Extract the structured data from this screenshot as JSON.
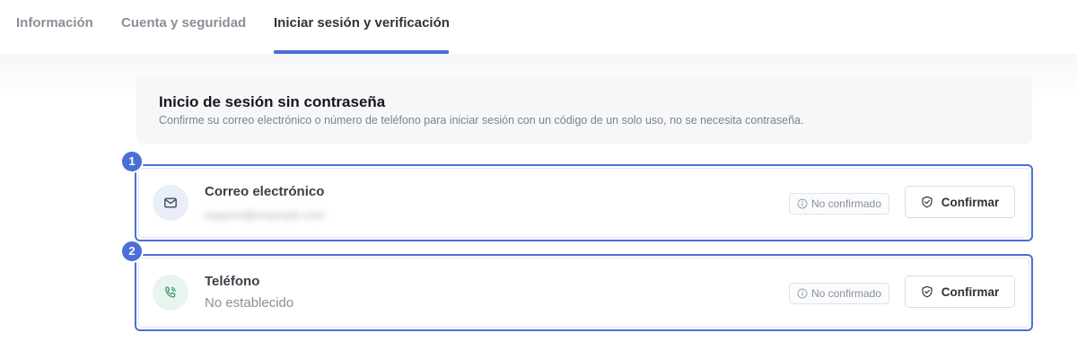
{
  "tabs": [
    {
      "label": "Información",
      "active": false
    },
    {
      "label": "Cuenta y seguridad",
      "active": false
    },
    {
      "label": "Iniciar sesión y verificación",
      "active": true
    }
  ],
  "section": {
    "title": "Inicio de sesión sin contraseña",
    "description": "Confirme su correo electrónico o número de teléfono para iniciar sesión con un código de un solo uso, no se necesita contraseña."
  },
  "rows": [
    {
      "marker": "1",
      "icon": "mail-icon",
      "title": "Correo electrónico",
      "value": "support@example.com",
      "value_blurred": true,
      "status": "No confirmado",
      "action": "Confirmar"
    },
    {
      "marker": "2",
      "icon": "phone-icon",
      "title": "Teléfono",
      "value": "No establecido",
      "value_blurred": false,
      "status": "No confirmado",
      "action": "Confirmar"
    }
  ],
  "colors": {
    "accent": "#4a6fd6",
    "mail_icon_bg": "#e9eef9",
    "phone_icon_bg": "#e8f5ee",
    "phone_icon": "#3f9a6a"
  }
}
